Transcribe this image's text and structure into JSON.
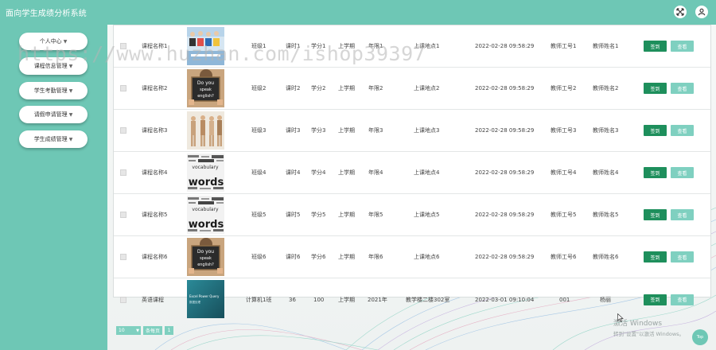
{
  "app": {
    "title": "面向学生成绩分析系统"
  },
  "icons": {
    "fullscreen": "fullscreen-icon",
    "user": "user-icon"
  },
  "sidebar": {
    "items": [
      {
        "label": "个人中心"
      },
      {
        "label": "课程信息管理"
      },
      {
        "label": "学生考勤管理"
      },
      {
        "label": "请假申请管理"
      },
      {
        "label": "学生成绩管理"
      }
    ]
  },
  "table": {
    "sign_label": "签到",
    "view_label": "查看",
    "rows": [
      {
        "course": "课程名称1",
        "class": "班级1",
        "hours": "课时1",
        "credit": "学分1",
        "term": "上学期",
        "year": "年限1",
        "location": "上课地点1",
        "time": "2022-02-28 09:58:29",
        "teacher_id": "教师工号1",
        "teacher_name": "教师姓名1",
        "image": "group-photo"
      },
      {
        "course": "课程名称2",
        "class": "班级2",
        "hours": "课时2",
        "credit": "学分2",
        "term": "上学期",
        "year": "年限2",
        "location": "上课地点2",
        "time": "2022-02-28 09:58:29",
        "teacher_id": "教师工号2",
        "teacher_name": "教师姓名2",
        "image": "chalkboard-sign"
      },
      {
        "course": "课程名称3",
        "class": "班级3",
        "hours": "课时3",
        "credit": "学分3",
        "term": "上学期",
        "year": "年限3",
        "location": "上课地点3",
        "time": "2022-02-28 09:58:29",
        "teacher_id": "教师工号3",
        "teacher_name": "教师姓名3",
        "image": "people-photo"
      },
      {
        "course": "课程名称4",
        "class": "班级4",
        "hours": "课时4",
        "credit": "学分4",
        "term": "上学期",
        "year": "年限4",
        "location": "上课地点4",
        "time": "2022-02-28 09:58:29",
        "teacher_id": "教师工号4",
        "teacher_name": "教师姓名4",
        "image": "vocabulary-words"
      },
      {
        "course": "课程名称5",
        "class": "班级5",
        "hours": "课时5",
        "credit": "学分5",
        "term": "上学期",
        "year": "年限5",
        "location": "上课地点5",
        "time": "2022-02-28 09:58:29",
        "teacher_id": "教师工号5",
        "teacher_name": "教师姓名5",
        "image": "vocabulary-words"
      },
      {
        "course": "课程名称6",
        "class": "班级6",
        "hours": "课时6",
        "credit": "学分6",
        "term": "上学期",
        "year": "年限6",
        "location": "上课地点6",
        "time": "2022-02-28 09:58:29",
        "teacher_id": "教师工号6",
        "teacher_name": "教师姓名6",
        "image": "chalkboard-sign"
      },
      {
        "course": "英语课程",
        "class": "计算机1班",
        "hours": "36",
        "credit": "100",
        "term": "上学期",
        "year": "2021年",
        "location": "教学楼二楼302室",
        "time": "2022-03-01 09:10:04",
        "teacher_id": "001",
        "teacher_name": "杨丽",
        "image": "book-cover"
      }
    ]
  },
  "thumb_text": {
    "sign_line1": "Do you",
    "sign_line2": "speak",
    "sign_line3": "english?",
    "vocab_small": "vocabulary",
    "vocab_big": "words",
    "book_line1": "Excel Power Query",
    "book_line2": "数据处理"
  },
  "pager": {
    "page_size": "10",
    "label": "条每页",
    "page": "1"
  },
  "watermark": "https://www.huzhan.com/ishop39397",
  "os_notice": {
    "line1": "激活 Windows",
    "line2": "转到\"设置\"以激活 Windows。"
  },
  "top_button": "Top",
  "colors": {
    "teal": "#6ec7b5",
    "sign_green": "#1e8f5c",
    "view_teal": "#7fd0c0"
  }
}
